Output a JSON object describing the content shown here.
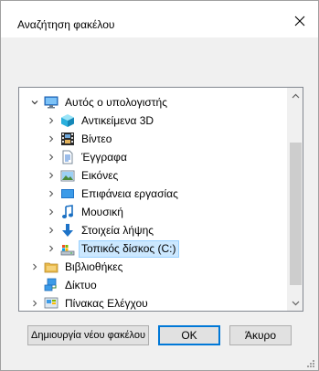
{
  "window": {
    "title": "Αναζήτηση φακέλου"
  },
  "tree": {
    "items": [
      {
        "label": "Αυτός ο υπολογιστής",
        "icon": "computer-icon",
        "expanded": true,
        "level": 0
      },
      {
        "label": "Αντικείμενα 3D",
        "icon": "3d-objects-icon",
        "level": 1
      },
      {
        "label": "Βίντεο",
        "icon": "video-icon",
        "level": 1
      },
      {
        "label": "Έγγραφα",
        "icon": "documents-icon",
        "level": 1
      },
      {
        "label": "Εικόνες",
        "icon": "pictures-icon",
        "level": 1
      },
      {
        "label": "Επιφάνεια εργασίας",
        "icon": "desktop-icon",
        "level": 1
      },
      {
        "label": "Μουσική",
        "icon": "music-icon",
        "level": 1
      },
      {
        "label": "Στοιχεία λήψης",
        "icon": "downloads-icon",
        "level": 1
      },
      {
        "label": "Τοπικός δίσκος (C:)",
        "icon": "local-disk-icon",
        "level": 1,
        "selected": true
      },
      {
        "label": "Βιβλιοθήκες",
        "icon": "libraries-icon",
        "level": 0
      },
      {
        "label": "Δίκτυο",
        "icon": "network-icon",
        "level": 0
      },
      {
        "label": "Πίνακας Ελέγχου",
        "icon": "control-panel-icon",
        "level": 0
      }
    ]
  },
  "buttons": {
    "new_folder": "Δημιουργία νέου φακέλου",
    "ok": "OK",
    "cancel": "Άκυρο"
  },
  "colors": {
    "selection": "#cce8ff",
    "accent": "#0078d7"
  }
}
